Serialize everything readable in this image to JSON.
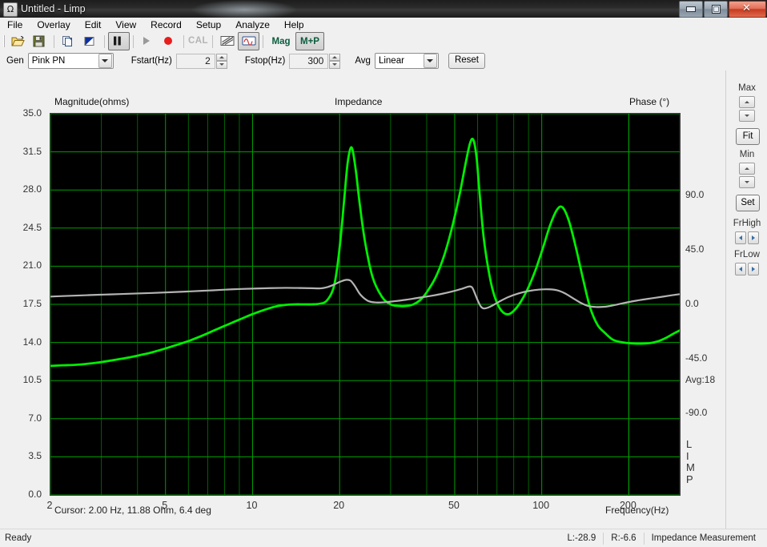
{
  "window": {
    "title": "Untitled - Limp",
    "app_icon": "omega-icon",
    "buttons": {
      "minimize": "minimize-icon",
      "maximize": "maximize-icon",
      "close": "✕"
    }
  },
  "menubar": {
    "items": [
      "File",
      "Overlay",
      "Edit",
      "View",
      "Record",
      "Setup",
      "Analyze",
      "Help"
    ]
  },
  "toolbar": {
    "buttons": [
      {
        "name": "open-button",
        "icon": "folder-open-icon",
        "label": "",
        "state": "normal"
      },
      {
        "name": "save-button",
        "icon": "floppy-disk-icon",
        "label": "",
        "state": "normal"
      },
      {
        "name": "copy-button",
        "icon": "copy-page-icon",
        "label": "",
        "state": "normal"
      },
      {
        "name": "color-button",
        "icon": "blue-triangle-icon",
        "label": "",
        "state": "normal"
      },
      {
        "name": "pause-button",
        "icon": "pause-icon",
        "label": "",
        "state": "pressed"
      },
      {
        "name": "play-button",
        "icon": "play-icon",
        "label": "",
        "state": "disabled"
      },
      {
        "name": "record-button",
        "icon": "record-dot-icon",
        "label": "",
        "state": "normal"
      },
      {
        "name": "calibrate-button",
        "icon": "cal-text-icon",
        "label": "CAL",
        "state": "disabled"
      },
      {
        "name": "impedance-button",
        "icon": "slope-graph-icon",
        "label": "",
        "state": "normal"
      },
      {
        "name": "waveform-button",
        "icon": "sine-wave-icon",
        "label": "",
        "state": "pressed"
      },
      {
        "name": "magnitude-button",
        "icon": "mag-text-icon",
        "label": "Mag",
        "state": "normal"
      },
      {
        "name": "mag-phase-button",
        "icon": "mplusp-text-icon",
        "label": "M+P",
        "state": "pressed"
      }
    ]
  },
  "genbar": {
    "gen_label": "Gen",
    "gen_value": "Pink PN",
    "fstart_label": "Fstart(Hz)",
    "fstart_value": "2",
    "fstop_label": "Fstop(Hz)",
    "fstop_value": "300",
    "avg_label": "Avg",
    "avg_value": "Linear",
    "reset_label": "Reset"
  },
  "sidebar": {
    "max_label": "Max",
    "fit_label": "Fit",
    "min_label": "Min",
    "set_label": "Set",
    "frhigh_label": "FrHigh",
    "frlow_label": "FrLow"
  },
  "chart_overlay": {
    "cursor_text": "Cursor: 2.00 Hz, 11.88 Ohm, 6.4 deg",
    "freq_label": "Frequency(Hz)",
    "avg_text": "Avg:18",
    "watermark": [
      "L",
      "I",
      "M",
      "P"
    ]
  },
  "statusbar": {
    "ready": "Ready",
    "left_level": "L:-28.9",
    "right_level": "R:-6.6",
    "mode": "Impedance Measurement"
  },
  "chart_data": {
    "type": "line",
    "title": "Impedance",
    "xlabel": "Frequency(Hz)",
    "ylabel": "Magnitude(ohms)",
    "y2label": "Phase (°)",
    "xscale": "log",
    "xlim": [
      2,
      300
    ],
    "xticks": [
      2,
      5,
      10,
      20,
      50,
      100,
      200
    ],
    "xticklabels": [
      "2",
      "5",
      "10",
      "20",
      "50",
      "100",
      "200"
    ],
    "ylim": [
      0.0,
      35.0
    ],
    "yticks": [
      0.0,
      3.5,
      7.0,
      10.5,
      14.0,
      17.5,
      21.0,
      24.5,
      28.0,
      31.5,
      35.0
    ],
    "yticklabels": [
      "0.0",
      "3.5",
      "7.0",
      "10.5",
      "14.0",
      "17.5",
      "21.0",
      "24.5",
      "28.0",
      "31.5",
      "35.0"
    ],
    "y2lim": [
      -157.5,
      157.5
    ],
    "y2ticks": [
      90.0,
      45.0,
      0.0,
      -45.0,
      -90.0
    ],
    "y2ticklabels": [
      "90.0",
      "45.0",
      "0.0",
      "-45.0",
      "-90.0"
    ],
    "grid": true,
    "grid_color": "#00a000",
    "background": "#000000",
    "legend": "none",
    "series": [
      {
        "name": "Magnitude",
        "color": "#00ee00",
        "axis": "left",
        "unit": "ohms",
        "points": [
          [
            2.0,
            11.85
          ],
          [
            2.2,
            11.9
          ],
          [
            2.45,
            11.95
          ],
          [
            2.7,
            12.05
          ],
          [
            3.0,
            12.2
          ],
          [
            3.3,
            12.38
          ],
          [
            3.7,
            12.6
          ],
          [
            4.1,
            12.85
          ],
          [
            4.5,
            13.1
          ],
          [
            5.0,
            13.45
          ],
          [
            5.5,
            13.8
          ],
          [
            6.1,
            14.2
          ],
          [
            6.8,
            14.7
          ],
          [
            7.5,
            15.2
          ],
          [
            8.3,
            15.7
          ],
          [
            9.1,
            16.15
          ],
          [
            10.0,
            16.6
          ],
          [
            11.0,
            17.0
          ],
          [
            12.0,
            17.3
          ],
          [
            13.0,
            17.45
          ],
          [
            14.0,
            17.5
          ],
          [
            15.0,
            17.5
          ],
          [
            16.0,
            17.5
          ],
          [
            17.0,
            17.55
          ],
          [
            18.0,
            17.8
          ],
          [
            19.0,
            18.9
          ],
          [
            19.6,
            20.8
          ],
          [
            20.2,
            23.8
          ],
          [
            20.8,
            27.5
          ],
          [
            21.3,
            30.4
          ],
          [
            21.8,
            31.8
          ],
          [
            22.2,
            31.6
          ],
          [
            22.8,
            29.6
          ],
          [
            23.5,
            26.6
          ],
          [
            24.5,
            23.2
          ],
          [
            26.0,
            20.0
          ],
          [
            28.0,
            18.2
          ],
          [
            30.0,
            17.5
          ],
          [
            32.0,
            17.35
          ],
          [
            34.0,
            17.35
          ],
          [
            36.0,
            17.5
          ],
          [
            38.0,
            17.9
          ],
          [
            40.0,
            18.6
          ],
          [
            43.0,
            20.0
          ],
          [
            46.0,
            22.0
          ],
          [
            49.0,
            24.6
          ],
          [
            52.0,
            27.6
          ],
          [
            54.5,
            30.4
          ],
          [
            56.5,
            32.3
          ],
          [
            58.0,
            32.6
          ],
          [
            59.5,
            31.0
          ],
          [
            61.0,
            27.6
          ],
          [
            63.0,
            23.6
          ],
          [
            65.5,
            20.6
          ],
          [
            68.0,
            18.6
          ],
          [
            71.0,
            17.3
          ],
          [
            74.0,
            16.7
          ],
          [
            77.0,
            16.6
          ],
          [
            80.0,
            16.9
          ],
          [
            84.0,
            17.6
          ],
          [
            89.0,
            18.8
          ],
          [
            95.0,
            20.6
          ],
          [
            101.0,
            22.7
          ],
          [
            107.0,
            24.8
          ],
          [
            113.0,
            26.2
          ],
          [
            118.0,
            26.4
          ],
          [
            124.0,
            25.2
          ],
          [
            131.0,
            22.8
          ],
          [
            139.0,
            19.8
          ],
          [
            147.0,
            17.2
          ],
          [
            156.0,
            15.6
          ],
          [
            165.0,
            14.9
          ],
          [
            175.0,
            14.3
          ],
          [
            186.0,
            14.05
          ],
          [
            198.0,
            13.95
          ],
          [
            210.0,
            13.9
          ],
          [
            224.0,
            13.9
          ],
          [
            238.0,
            13.95
          ],
          [
            252.0,
            14.1
          ],
          [
            268.0,
            14.4
          ],
          [
            285.0,
            14.8
          ],
          [
            300.0,
            15.1
          ]
        ]
      },
      {
        "name": "Phase",
        "color": "#b4b4b4",
        "axis": "right",
        "unit": "deg",
        "points": [
          [
            2.0,
            6.4
          ],
          [
            2.3,
            7.0
          ],
          [
            2.7,
            7.6
          ],
          [
            3.2,
            8.2
          ],
          [
            3.8,
            8.8
          ],
          [
            4.5,
            9.4
          ],
          [
            5.3,
            10.1
          ],
          [
            6.2,
            10.8
          ],
          [
            7.3,
            11.6
          ],
          [
            8.5,
            12.4
          ],
          [
            10.0,
            13.0
          ],
          [
            11.5,
            13.4
          ],
          [
            13.0,
            13.6
          ],
          [
            14.5,
            13.5
          ],
          [
            16.0,
            13.3
          ],
          [
            17.2,
            13.2
          ],
          [
            18.0,
            14.0
          ],
          [
            19.0,
            16.0
          ],
          [
            20.0,
            18.5
          ],
          [
            21.0,
            20.2
          ],
          [
            21.8,
            19.6
          ],
          [
            22.6,
            15.0
          ],
          [
            23.6,
            8.0
          ],
          [
            25.0,
            3.0
          ],
          [
            26.5,
            1.6
          ],
          [
            28.5,
            1.7
          ],
          [
            31.0,
            2.6
          ],
          [
            34.0,
            3.8
          ],
          [
            37.0,
            5.2
          ],
          [
            41.0,
            6.8
          ],
          [
            45.0,
            8.6
          ],
          [
            49.0,
            10.6
          ],
          [
            52.5,
            12.6
          ],
          [
            55.0,
            14.2
          ],
          [
            56.5,
            14.8
          ],
          [
            57.5,
            13.8
          ],
          [
            58.5,
            10.0
          ],
          [
            60.0,
            3.5
          ],
          [
            61.5,
            -1.6
          ],
          [
            63.0,
            -3.4
          ],
          [
            65.0,
            -2.8
          ],
          [
            68.0,
            -0.6
          ],
          [
            72.0,
            2.8
          ],
          [
            77.0,
            6.2
          ],
          [
            83.0,
            9.0
          ],
          [
            90.0,
            11.0
          ],
          [
            98.0,
            12.2
          ],
          [
            106.0,
            12.4
          ],
          [
            113.0,
            11.6
          ],
          [
            120.0,
            9.2
          ],
          [
            128.0,
            5.2
          ],
          [
            136.0,
            1.4
          ],
          [
            144.0,
            -1.2
          ],
          [
            154.0,
            -2.2
          ],
          [
            165.0,
            -2.0
          ],
          [
            177.0,
            -0.8
          ],
          [
            190.0,
            0.8
          ],
          [
            205.0,
            2.4
          ],
          [
            222.0,
            3.8
          ],
          [
            240.0,
            5.0
          ],
          [
            260.0,
            6.2
          ],
          [
            280.0,
            7.4
          ],
          [
            300.0,
            8.4
          ]
        ]
      }
    ],
    "resonance_peaks": [
      {
        "frequency": 21.8,
        "impedance": 31.8
      },
      {
        "frequency": 58.0,
        "impedance": 32.6
      },
      {
        "frequency": 118.0,
        "impedance": 26.4
      }
    ]
  }
}
